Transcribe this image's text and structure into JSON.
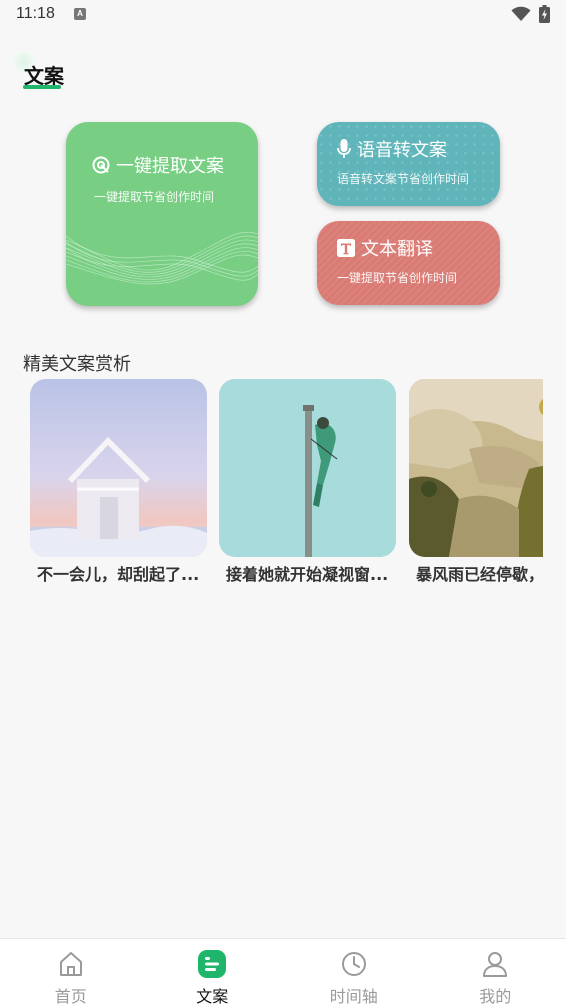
{
  "status_bar": {
    "time": "11:18",
    "notification_icon": "a-notification-icon"
  },
  "header": {
    "title": "文案"
  },
  "features": {
    "extract": {
      "title": "一键提取文案",
      "subtitle": "一键提取节省创作时间",
      "color": "#78cf84",
      "icon": "extract-icon"
    },
    "voice": {
      "title": "语音转文案",
      "subtitle": "语音转文案节省创作时间",
      "color": "#5fb5ba",
      "icon": "microphone-icon"
    },
    "translate": {
      "title": "文本翻译",
      "subtitle": "一键提取节省创作时间",
      "color": "#d97b74",
      "icon": "text-icon"
    }
  },
  "gallery": {
    "title": "精美文案赏析",
    "items": [
      {
        "caption": "不一会儿，却刮起了...",
        "image": "frosted-house"
      },
      {
        "caption": "接着她就开始凝视窗...",
        "image": "climber-on-pole"
      },
      {
        "caption": "暴风雨已经停歇，",
        "image": "rocky-landscape"
      }
    ]
  },
  "nav": {
    "items": [
      {
        "label": "首页",
        "icon": "home-icon"
      },
      {
        "label": "文案",
        "icon": "document-icon"
      },
      {
        "label": "时间轴",
        "icon": "clock-icon"
      },
      {
        "label": "我的",
        "icon": "user-icon"
      }
    ],
    "active_index": 1,
    "accent": "#1fb56a"
  }
}
